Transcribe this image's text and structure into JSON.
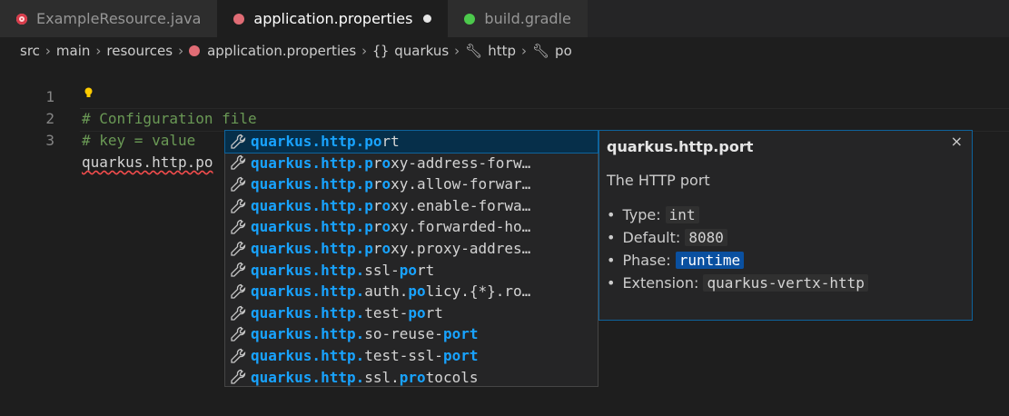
{
  "tabs": [
    {
      "label": "ExampleResource.java",
      "icon": "java-file-icon",
      "active": false
    },
    {
      "label": "application.properties",
      "icon": "properties-file-icon",
      "active": true,
      "modified": true
    },
    {
      "label": "build.gradle",
      "icon": "gradle-file-icon",
      "active": false
    }
  ],
  "breadcrumb": {
    "items": [
      "src",
      "main",
      "resources",
      "application.properties",
      "quarkus",
      "http",
      "po"
    ],
    "braces": "{}"
  },
  "editor": {
    "lines": [
      {
        "num": "1",
        "text": "# Configuration file"
      },
      {
        "num": "2",
        "text": "# key = value"
      },
      {
        "num": "3",
        "text": "quarkus.http.po"
      }
    ]
  },
  "suggestions": [
    {
      "prefix": "quarkus.http.",
      "match": "po",
      "rest": "rt",
      "selected": true
    },
    {
      "prefix": "quarkus.http.",
      "match": "p",
      "mid": "r",
      "match2": "o",
      "rest": "xy-address-forw…"
    },
    {
      "prefix": "quarkus.http.",
      "match": "p",
      "mid": "r",
      "match2": "o",
      "rest": "xy.allow-forwar…"
    },
    {
      "prefix": "quarkus.http.",
      "match": "p",
      "mid": "r",
      "match2": "o",
      "rest": "xy.enable-forwa…"
    },
    {
      "prefix": "quarkus.http.",
      "match": "p",
      "mid": "r",
      "match2": "o",
      "rest": "xy.forwarded-ho…"
    },
    {
      "prefix": "quarkus.http.",
      "match": "p",
      "mid": "r",
      "match2": "o",
      "rest": "xy.proxy-addres…"
    },
    {
      "prefix": "quarkus.http.",
      "pre": "ssl-",
      "match": "po",
      "rest": "rt"
    },
    {
      "prefix": "quarkus.http.",
      "pre": "auth.",
      "match": "po",
      "rest": "licy.{*}.ro…"
    },
    {
      "prefix": "quarkus.http.",
      "pre": "test-",
      "match": "po",
      "rest": "rt"
    },
    {
      "prefix": "quarkus.http.",
      "pre": "so-reuse-",
      "match": "port",
      "rest": ""
    },
    {
      "prefix": "quarkus.http.",
      "pre": "test-ssl-",
      "match": "port",
      "rest": ""
    },
    {
      "prefix": "quarkus.http.",
      "pre": "ssl.",
      "match": "pro",
      "rest": "tocols"
    }
  ],
  "details": {
    "title": "quarkus.http.port",
    "close": "×",
    "description": "The HTTP port",
    "props": [
      {
        "label": "Type:",
        "value": "int"
      },
      {
        "label": "Default:",
        "value": "8080"
      },
      {
        "label": "Phase:",
        "value": "runtime",
        "highlight": true
      },
      {
        "label": "Extension:",
        "value": "quarkus-vertx-http"
      }
    ]
  },
  "colors": {
    "match": "#18a3ff",
    "selection": "#062f4a",
    "accent": "#0e639c"
  }
}
